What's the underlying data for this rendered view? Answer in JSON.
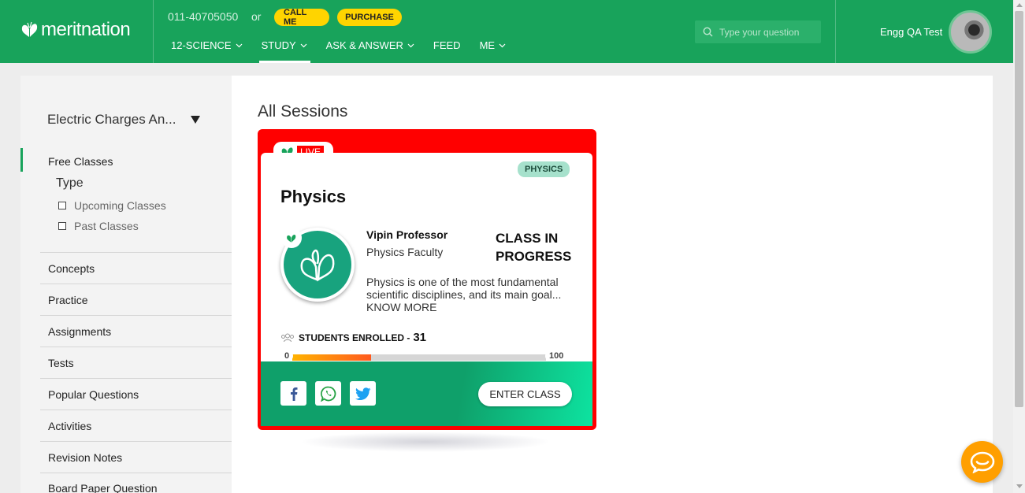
{
  "header": {
    "brand": "meritnation",
    "phone": "011-40705050",
    "or_text": "or",
    "call_label": "CALL ME",
    "purchase_label": "PURCHASE",
    "nav": [
      {
        "label": "12-SCIENCE",
        "has_caret": true
      },
      {
        "label": "STUDY",
        "has_caret": true,
        "active": true
      },
      {
        "label": "ASK & ANSWER",
        "has_caret": true
      },
      {
        "label": "FEED",
        "has_caret": false
      },
      {
        "label": "ME",
        "has_caret": true
      }
    ],
    "search_placeholder": "Type your question",
    "username": "Engg QA Test",
    "brand_color": "#18a35b"
  },
  "sidebar": {
    "chapter": "Electric Charges An...",
    "free_classes": "Free Classes",
    "type_label": "Type",
    "filters": [
      "Upcoming Classes",
      "Past Classes"
    ],
    "items": [
      "Concepts",
      "Practice",
      "Assignments",
      "Tests",
      "Popular Questions",
      "Activities",
      "Revision Notes",
      "Board Paper Question"
    ]
  },
  "main": {
    "title": "All Sessions",
    "card": {
      "live_label": "LIVE",
      "subject_badge": "PHYSICS",
      "title": "Physics",
      "teacher_name": "Vipin Professor",
      "teacher_role": "Physics Faculty",
      "status": "CLASS IN PROGRESS",
      "description": "Physics is one of the most fundamental scientific disciplines, and its main goal...",
      "know_more": "KNOW MORE",
      "students_label": "STUDENTS ENROLLED -",
      "students_count": "31",
      "progress_min": "0",
      "progress_max": "100",
      "progress_value": 31,
      "enter_label": "ENTER CLASS",
      "accent_color": "#ff0000"
    }
  }
}
